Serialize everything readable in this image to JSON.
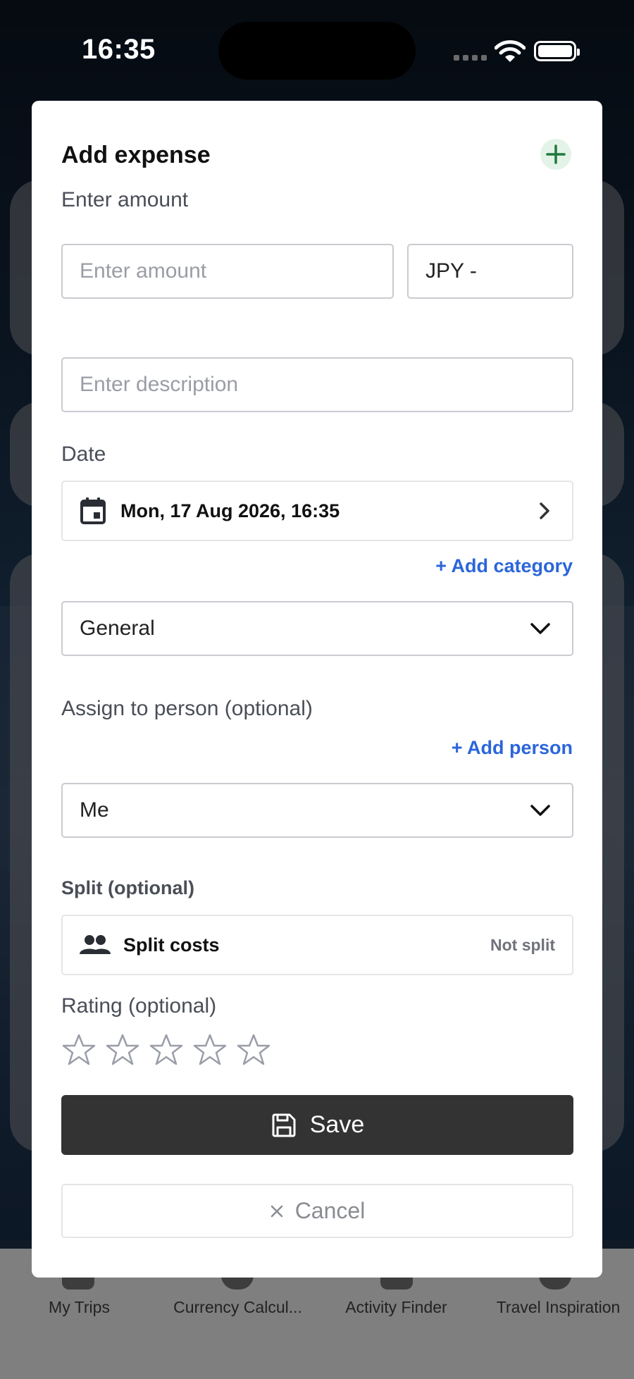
{
  "status_bar": {
    "time": "16:35"
  },
  "modal": {
    "title": "Add expense",
    "amount_label": "Enter amount",
    "amount_placeholder": "Enter amount",
    "currency_value": "JPY -",
    "description_placeholder": "Enter description",
    "date_label": "Date",
    "date_value": "Mon, 17 Aug 2026, 16:35",
    "add_category_link": "+ Add category",
    "category_value": "General",
    "assign_label": "Assign to person (optional)",
    "add_person_link": "+ Add person",
    "person_value": "Me",
    "split_label": "Split (optional)",
    "split_title": "Split costs",
    "split_status": "Not split",
    "rating_label": "Rating (optional)",
    "rating_value": 0,
    "rating_max": 5,
    "save_label": "Save",
    "cancel_label": "Cancel"
  },
  "tab_bar": {
    "tabs": [
      {
        "label": "My Trips"
      },
      {
        "label": "Currency Calcul..."
      },
      {
        "label": "Activity Finder"
      },
      {
        "label": "Travel Inspiration"
      }
    ]
  },
  "colors": {
    "link": "#2b66d9",
    "save_button": "#333333",
    "add_icon": "#1f7a3a"
  }
}
